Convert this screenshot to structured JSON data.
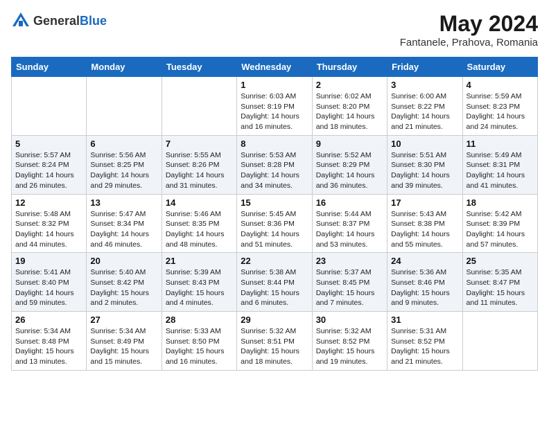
{
  "header": {
    "logo_general": "General",
    "logo_blue": "Blue",
    "month_year": "May 2024",
    "location": "Fantanele, Prahova, Romania"
  },
  "days_of_week": [
    "Sunday",
    "Monday",
    "Tuesday",
    "Wednesday",
    "Thursday",
    "Friday",
    "Saturday"
  ],
  "weeks": [
    [
      {
        "day": "",
        "sunrise": "",
        "sunset": "",
        "daylight": ""
      },
      {
        "day": "",
        "sunrise": "",
        "sunset": "",
        "daylight": ""
      },
      {
        "day": "",
        "sunrise": "",
        "sunset": "",
        "daylight": ""
      },
      {
        "day": "1",
        "sunrise": "Sunrise: 6:03 AM",
        "sunset": "Sunset: 8:19 PM",
        "daylight": "Daylight: 14 hours and 16 minutes."
      },
      {
        "day": "2",
        "sunrise": "Sunrise: 6:02 AM",
        "sunset": "Sunset: 8:20 PM",
        "daylight": "Daylight: 14 hours and 18 minutes."
      },
      {
        "day": "3",
        "sunrise": "Sunrise: 6:00 AM",
        "sunset": "Sunset: 8:22 PM",
        "daylight": "Daylight: 14 hours and 21 minutes."
      },
      {
        "day": "4",
        "sunrise": "Sunrise: 5:59 AM",
        "sunset": "Sunset: 8:23 PM",
        "daylight": "Daylight: 14 hours and 24 minutes."
      }
    ],
    [
      {
        "day": "5",
        "sunrise": "Sunrise: 5:57 AM",
        "sunset": "Sunset: 8:24 PM",
        "daylight": "Daylight: 14 hours and 26 minutes."
      },
      {
        "day": "6",
        "sunrise": "Sunrise: 5:56 AM",
        "sunset": "Sunset: 8:25 PM",
        "daylight": "Daylight: 14 hours and 29 minutes."
      },
      {
        "day": "7",
        "sunrise": "Sunrise: 5:55 AM",
        "sunset": "Sunset: 8:26 PM",
        "daylight": "Daylight: 14 hours and 31 minutes."
      },
      {
        "day": "8",
        "sunrise": "Sunrise: 5:53 AM",
        "sunset": "Sunset: 8:28 PM",
        "daylight": "Daylight: 14 hours and 34 minutes."
      },
      {
        "day": "9",
        "sunrise": "Sunrise: 5:52 AM",
        "sunset": "Sunset: 8:29 PM",
        "daylight": "Daylight: 14 hours and 36 minutes."
      },
      {
        "day": "10",
        "sunrise": "Sunrise: 5:51 AM",
        "sunset": "Sunset: 8:30 PM",
        "daylight": "Daylight: 14 hours and 39 minutes."
      },
      {
        "day": "11",
        "sunrise": "Sunrise: 5:49 AM",
        "sunset": "Sunset: 8:31 PM",
        "daylight": "Daylight: 14 hours and 41 minutes."
      }
    ],
    [
      {
        "day": "12",
        "sunrise": "Sunrise: 5:48 AM",
        "sunset": "Sunset: 8:32 PM",
        "daylight": "Daylight: 14 hours and 44 minutes."
      },
      {
        "day": "13",
        "sunrise": "Sunrise: 5:47 AM",
        "sunset": "Sunset: 8:34 PM",
        "daylight": "Daylight: 14 hours and 46 minutes."
      },
      {
        "day": "14",
        "sunrise": "Sunrise: 5:46 AM",
        "sunset": "Sunset: 8:35 PM",
        "daylight": "Daylight: 14 hours and 48 minutes."
      },
      {
        "day": "15",
        "sunrise": "Sunrise: 5:45 AM",
        "sunset": "Sunset: 8:36 PM",
        "daylight": "Daylight: 14 hours and 51 minutes."
      },
      {
        "day": "16",
        "sunrise": "Sunrise: 5:44 AM",
        "sunset": "Sunset: 8:37 PM",
        "daylight": "Daylight: 14 hours and 53 minutes."
      },
      {
        "day": "17",
        "sunrise": "Sunrise: 5:43 AM",
        "sunset": "Sunset: 8:38 PM",
        "daylight": "Daylight: 14 hours and 55 minutes."
      },
      {
        "day": "18",
        "sunrise": "Sunrise: 5:42 AM",
        "sunset": "Sunset: 8:39 PM",
        "daylight": "Daylight: 14 hours and 57 minutes."
      }
    ],
    [
      {
        "day": "19",
        "sunrise": "Sunrise: 5:41 AM",
        "sunset": "Sunset: 8:40 PM",
        "daylight": "Daylight: 14 hours and 59 minutes."
      },
      {
        "day": "20",
        "sunrise": "Sunrise: 5:40 AM",
        "sunset": "Sunset: 8:42 PM",
        "daylight": "Daylight: 15 hours and 2 minutes."
      },
      {
        "day": "21",
        "sunrise": "Sunrise: 5:39 AM",
        "sunset": "Sunset: 8:43 PM",
        "daylight": "Daylight: 15 hours and 4 minutes."
      },
      {
        "day": "22",
        "sunrise": "Sunrise: 5:38 AM",
        "sunset": "Sunset: 8:44 PM",
        "daylight": "Daylight: 15 hours and 6 minutes."
      },
      {
        "day": "23",
        "sunrise": "Sunrise: 5:37 AM",
        "sunset": "Sunset: 8:45 PM",
        "daylight": "Daylight: 15 hours and 7 minutes."
      },
      {
        "day": "24",
        "sunrise": "Sunrise: 5:36 AM",
        "sunset": "Sunset: 8:46 PM",
        "daylight": "Daylight: 15 hours and 9 minutes."
      },
      {
        "day": "25",
        "sunrise": "Sunrise: 5:35 AM",
        "sunset": "Sunset: 8:47 PM",
        "daylight": "Daylight: 15 hours and 11 minutes."
      }
    ],
    [
      {
        "day": "26",
        "sunrise": "Sunrise: 5:34 AM",
        "sunset": "Sunset: 8:48 PM",
        "daylight": "Daylight: 15 hours and 13 minutes."
      },
      {
        "day": "27",
        "sunrise": "Sunrise: 5:34 AM",
        "sunset": "Sunset: 8:49 PM",
        "daylight": "Daylight: 15 hours and 15 minutes."
      },
      {
        "day": "28",
        "sunrise": "Sunrise: 5:33 AM",
        "sunset": "Sunset: 8:50 PM",
        "daylight": "Daylight: 15 hours and 16 minutes."
      },
      {
        "day": "29",
        "sunrise": "Sunrise: 5:32 AM",
        "sunset": "Sunset: 8:51 PM",
        "daylight": "Daylight: 15 hours and 18 minutes."
      },
      {
        "day": "30",
        "sunrise": "Sunrise: 5:32 AM",
        "sunset": "Sunset: 8:52 PM",
        "daylight": "Daylight: 15 hours and 19 minutes."
      },
      {
        "day": "31",
        "sunrise": "Sunrise: 5:31 AM",
        "sunset": "Sunset: 8:52 PM",
        "daylight": "Daylight: 15 hours and 21 minutes."
      },
      {
        "day": "",
        "sunrise": "",
        "sunset": "",
        "daylight": ""
      }
    ]
  ]
}
